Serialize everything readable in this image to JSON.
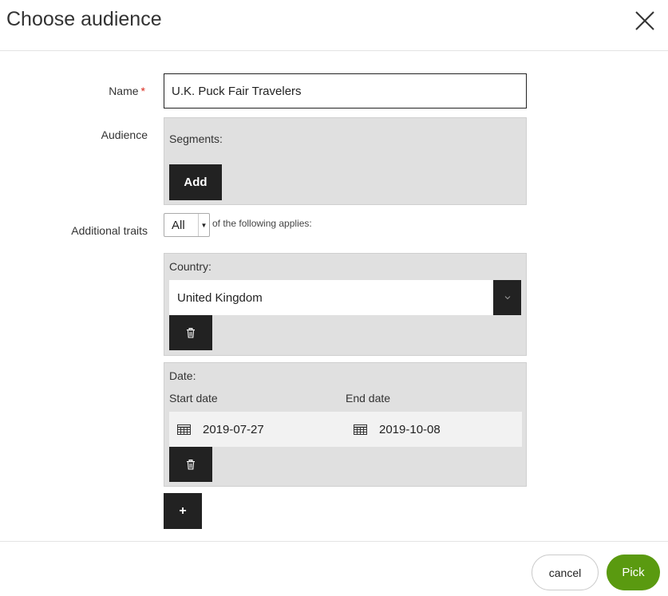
{
  "header": {
    "title": "Choose audience",
    "close_icon": "close-icon"
  },
  "form": {
    "name_label": "Name",
    "required_mark": "*",
    "name_value": "U.K. Puck Fair Travelers",
    "audience_label": "Audience",
    "segments_heading": "Segments:",
    "add_label": "Add",
    "additional_traits_label": "Additional traits",
    "traits_match_value": "All",
    "traits_match_suffix": "of the following applies:"
  },
  "traits": {
    "country": {
      "heading": "Country:",
      "value": "United Kingdom",
      "dropdown_icon": "chevron-down-icon",
      "delete_icon": "trash-icon"
    },
    "date": {
      "heading": "Date:",
      "start_label": "Start date",
      "end_label": "End date",
      "start_value": "2019-07-27",
      "end_value": "2019-10-08",
      "calendar_icon": "calendar-icon",
      "delete_icon": "trash-icon"
    },
    "add_trait_label": "+"
  },
  "footer": {
    "cancel_label": "cancel",
    "pick_label": "Pick"
  },
  "colors": {
    "dark_button": "#222222",
    "panel_bg": "#e0e0e0",
    "pick_green": "#5a9a10",
    "required_red": "#d9291c"
  }
}
